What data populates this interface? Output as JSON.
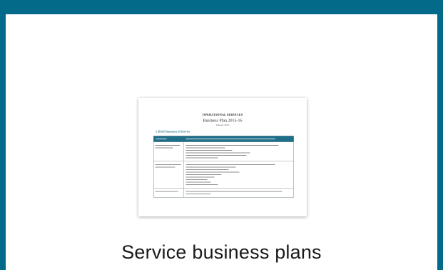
{
  "tile": {
    "caption": "Service business plans",
    "accent_color": "#046a8a"
  },
  "thumbnail": {
    "icon": "document-preview-icon",
    "heading": "OPERATIONAL SERVICES",
    "subheading": "Business Plan 2015-16",
    "date_line": "January 2015",
    "section_title": "1. Brief Summary of Service"
  }
}
